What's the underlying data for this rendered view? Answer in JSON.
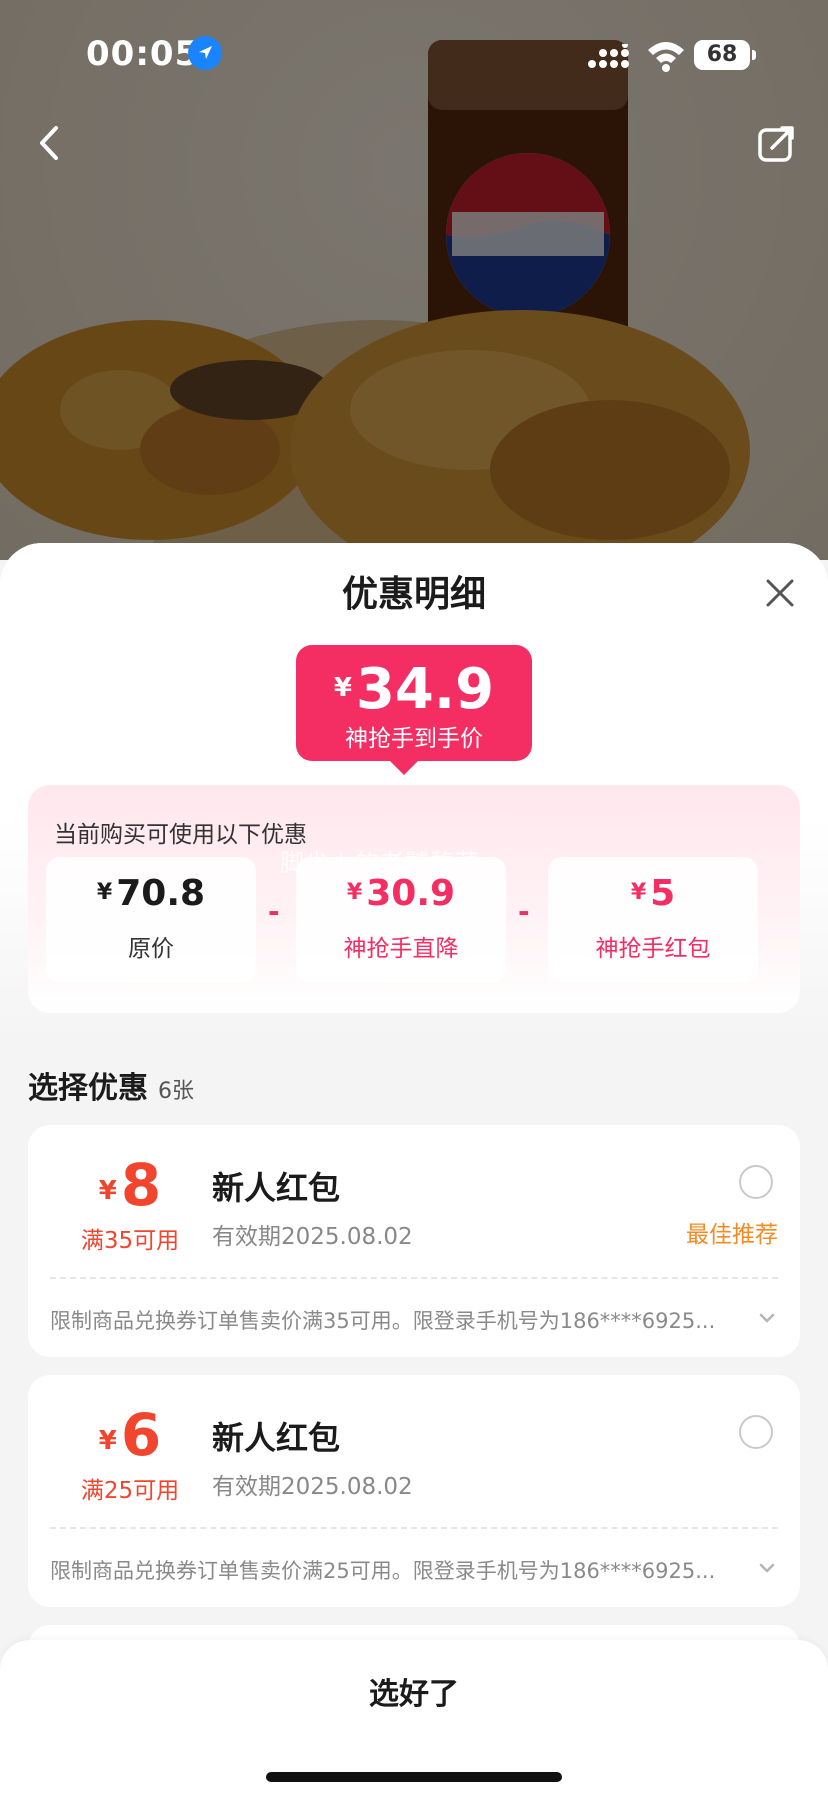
{
  "status_bar": {
    "time": "00:05",
    "battery": "68"
  },
  "sheet": {
    "title": "优惠明细",
    "final_price": {
      "currency": "¥",
      "amount": "34.9",
      "label": "神抢手到手价"
    },
    "calc": {
      "title": "当前购买可使用以下优惠",
      "watermark": "脚尖上的老饕馥菜",
      "items": [
        {
          "currency": "¥",
          "amount": "70.8",
          "label": "原价"
        },
        {
          "currency": "¥",
          "amount": "30.9",
          "label": "神抢手直降"
        },
        {
          "currency": "¥",
          "amount": "5",
          "label": "神抢手红包"
        }
      ],
      "operator": "-"
    },
    "select": {
      "title": "选择优惠",
      "count": "6张"
    },
    "coupons": [
      {
        "currency": "¥",
        "amount": "8",
        "condition": "满35可用",
        "name": "新人红包",
        "validity": "有效期2025.08.02",
        "tag": "最佳推荐",
        "desc": "限制商品兑换券订单售卖价满35可用。限登录手机号为186****6925..."
      },
      {
        "currency": "¥",
        "amount": "6",
        "condition": "满25可用",
        "name": "新人红包",
        "validity": "有效期2025.08.02",
        "tag": "",
        "desc": "限制商品兑换券订单售卖价满25可用。限登录手机号为186****6925..."
      }
    ],
    "confirm_label": "选好了"
  },
  "colors": {
    "accent_pink": "#f42d62",
    "coupon_red": "#f2452e",
    "tag_orange": "#f48b23"
  }
}
